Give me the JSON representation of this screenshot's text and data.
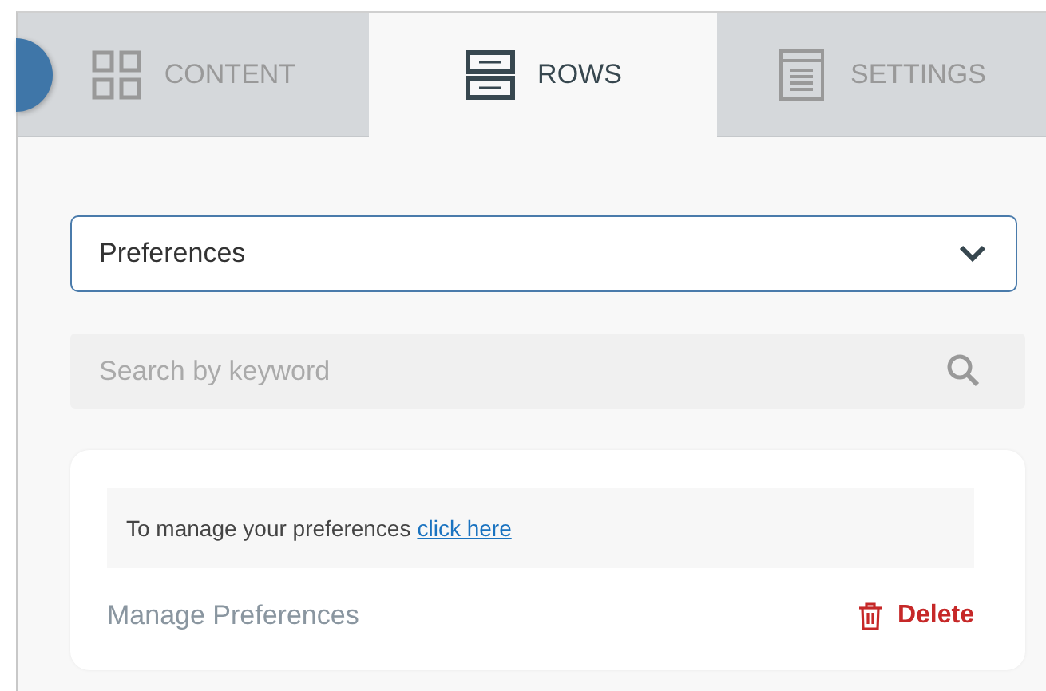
{
  "tabs": [
    {
      "label": "CONTENT",
      "selected": false
    },
    {
      "label": "ROWS",
      "selected": true
    },
    {
      "label": "SETTINGS",
      "selected": false
    }
  ],
  "row_select": {
    "value": "Preferences"
  },
  "search": {
    "placeholder": "Search by keyword"
  },
  "row_card": {
    "note": "To manage your preferences",
    "link": "click here",
    "name": "Manage Preferences",
    "delete_label": "Delete"
  }
}
